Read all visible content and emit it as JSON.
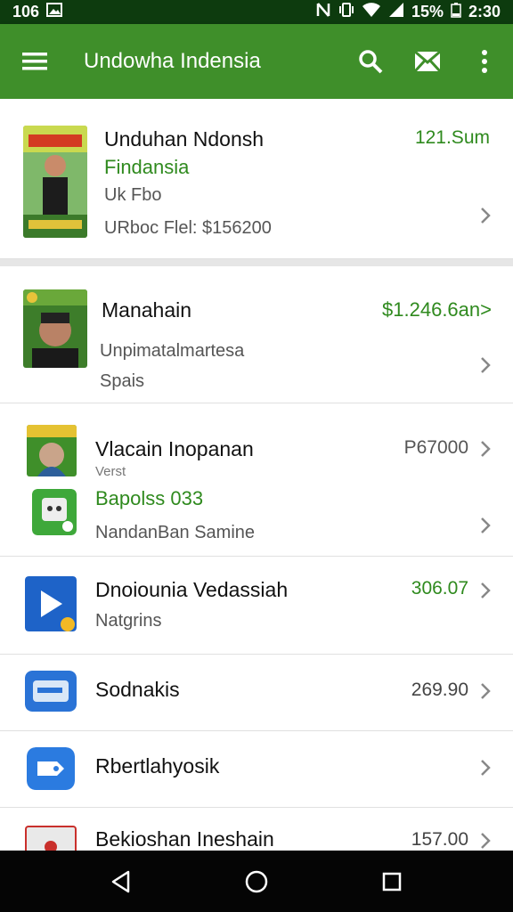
{
  "status_bar": {
    "time_left": "106",
    "battery_pct": "15%",
    "clock": "2:30"
  },
  "app_bar": {
    "title": "Undowha Indensia"
  },
  "items": [
    {
      "name": "Unduhan Ndonsh",
      "line2": "Findansia",
      "line3": "Uk Fbo",
      "line4": "URboc Flel: $156200",
      "price": "121.Sum"
    },
    {
      "name": "Manahain",
      "line2": "Unpimatalmartesa",
      "line3": "Spais",
      "price": "$1.246.6an>"
    },
    {
      "name": "Vlacain Inopanan",
      "line2": "Verst",
      "line3": "Bapolss 033",
      "line4": "NandanBan Samine",
      "price": "P67000"
    },
    {
      "name": "Dnoiounia Vedassiah",
      "line2": "Natgrins",
      "price": "306.07"
    },
    {
      "name": "Sodnakis",
      "price": "269.90"
    },
    {
      "name": "Rbertlahyosik"
    },
    {
      "name": "Bekioshan Ineshain",
      "price": "157.00"
    }
  ],
  "colors": {
    "app_bar": "#3f8f2a",
    "status_bar": "#0d3b0e",
    "accent_green": "#2f8a1e",
    "nav_bar": "#050505"
  }
}
